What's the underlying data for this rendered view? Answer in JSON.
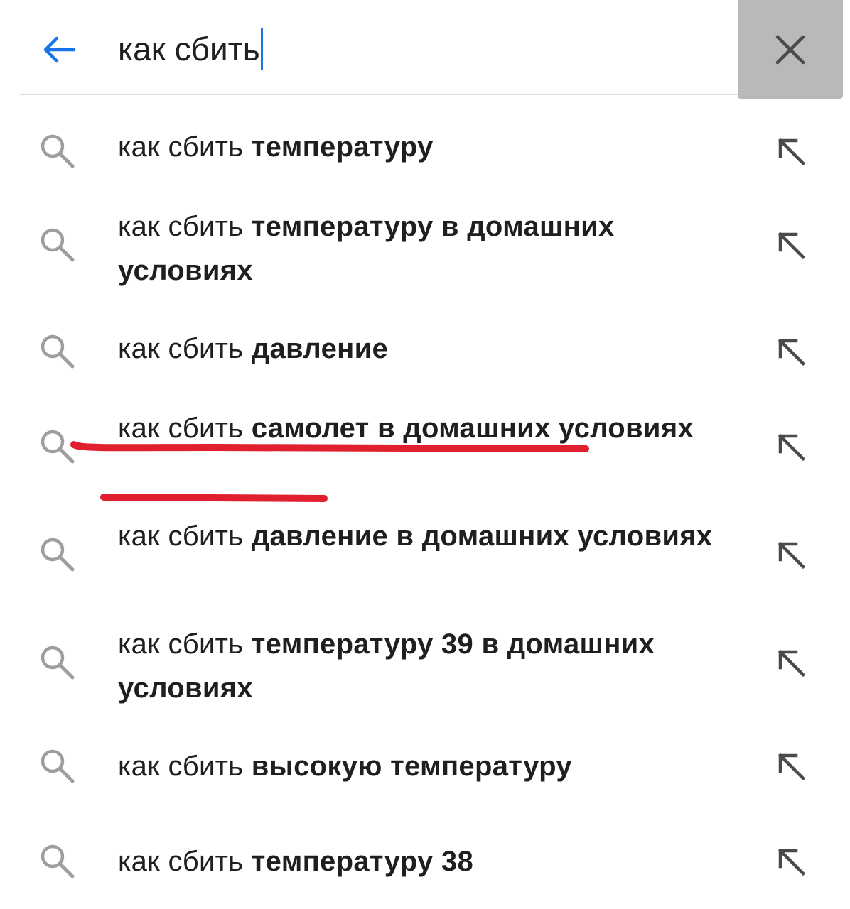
{
  "search": {
    "query": "как сбить"
  },
  "suggestions": [
    {
      "prefix": "как сбить",
      "completion": "температуру"
    },
    {
      "prefix": "как сбить",
      "completion": "температуру в домашних условиях"
    },
    {
      "prefix": "как сбить",
      "completion": "давление"
    },
    {
      "prefix": "как сбить",
      "completion": "самолет в домашних условиях"
    },
    {
      "prefix": "как сбить",
      "completion": "давление в домашних условиях"
    },
    {
      "prefix": "как сбить",
      "completion": "температуру 39 в домашних условиях"
    },
    {
      "prefix": "как сбить",
      "completion": "высокую температуру"
    },
    {
      "prefix": "как сбить",
      "completion": "температуру 38"
    }
  ],
  "icons": {
    "back": "arrow-left-icon",
    "clear": "close-icon",
    "suggestion": "search-icon",
    "fill": "arrow-up-left-icon"
  },
  "colors": {
    "accent": "#1a73e8",
    "annotation": "#e0202e",
    "icon_gray": "#9e9e9e",
    "clear_bg": "#b9b9b9"
  }
}
